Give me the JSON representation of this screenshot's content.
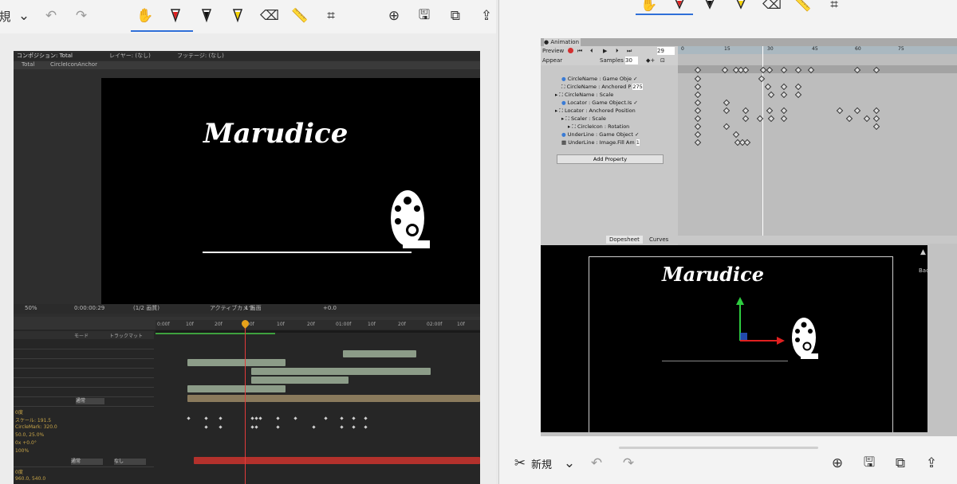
{
  "left_window": {
    "toolbar": {
      "cut_label": "規"
    },
    "after_effects": {
      "comp_tab": "コンポジション: Total",
      "layer_tab": "レイヤー: (なし)",
      "footage_tab": "フッテージ: (なし)",
      "breadcrumb_total": "Total",
      "breadcrumb_anchor": "CircleIconAnchor",
      "zoom": "50%",
      "timecode": "0:00:00:29",
      "resolution": "(1/2 画質)",
      "camera": "アクティブカメラ",
      "views": "1 画面",
      "exposure": "+0.0",
      "layer_header_mode": "モード",
      "layer_header_trkmat": "トラックマット",
      "mode_none": "なし",
      "mode_normal": "通常",
      "mode_normal2": "通常",
      "property_values": [
        "0度",
        "スケール: 191.5",
        "CircleMark: 320.0",
        "50.0, 25.0%",
        "0x +0.0°",
        "100%",
        "0度",
        "960.0, 540.0"
      ],
      "ruler_ticks": [
        "0:00f",
        "10f",
        "20f",
        "00f",
        "10f",
        "20f",
        "01:00f",
        "10f",
        "20f",
        "02:00f",
        "10f"
      ]
    },
    "comp": {
      "logo_text": "Marudice"
    }
  },
  "right_window": {
    "animation": {
      "tab_title": "Animation",
      "preview_label": "Preview",
      "frame_value": "29",
      "clip_name": "Appear",
      "samples_label": "Samples",
      "samples_value": "30",
      "ruler_ticks": [
        "0",
        "15",
        "30",
        "45",
        "60",
        "75"
      ],
      "properties": [
        {
          "label": "CircleName : Game Obje",
          "value": "✓"
        },
        {
          "label": "CircleName : Anchored P",
          "value": "275"
        },
        {
          "label": "CircleName : Scale",
          "value": ""
        },
        {
          "label": "Locator : Game Object.Is",
          "value": "✓"
        },
        {
          "label": "Locator : Anchored Position",
          "value": ""
        },
        {
          "label": "Scaler : Scale",
          "value": ""
        },
        {
          "label": "CircleIcon : Rotation",
          "value": ""
        },
        {
          "label": "UnderLine : Game Object",
          "value": "✓"
        },
        {
          "label": "UnderLine : Image.Fill Am",
          "value": "1"
        }
      ],
      "add_property": "Add Property",
      "tab_dopesheet": "Dopesheet",
      "tab_curves": "Curves"
    },
    "scene": {
      "logo_text": "Marudice",
      "back_label": "Back"
    },
    "bottom_bar": {
      "new_label": "新規"
    }
  },
  "colors": {
    "selection_blue": "#2f6fd8",
    "ae_key_green": "#8c9c88",
    "ae_orange": "#e6a11a",
    "ae_red_bar": "#b3312c"
  }
}
